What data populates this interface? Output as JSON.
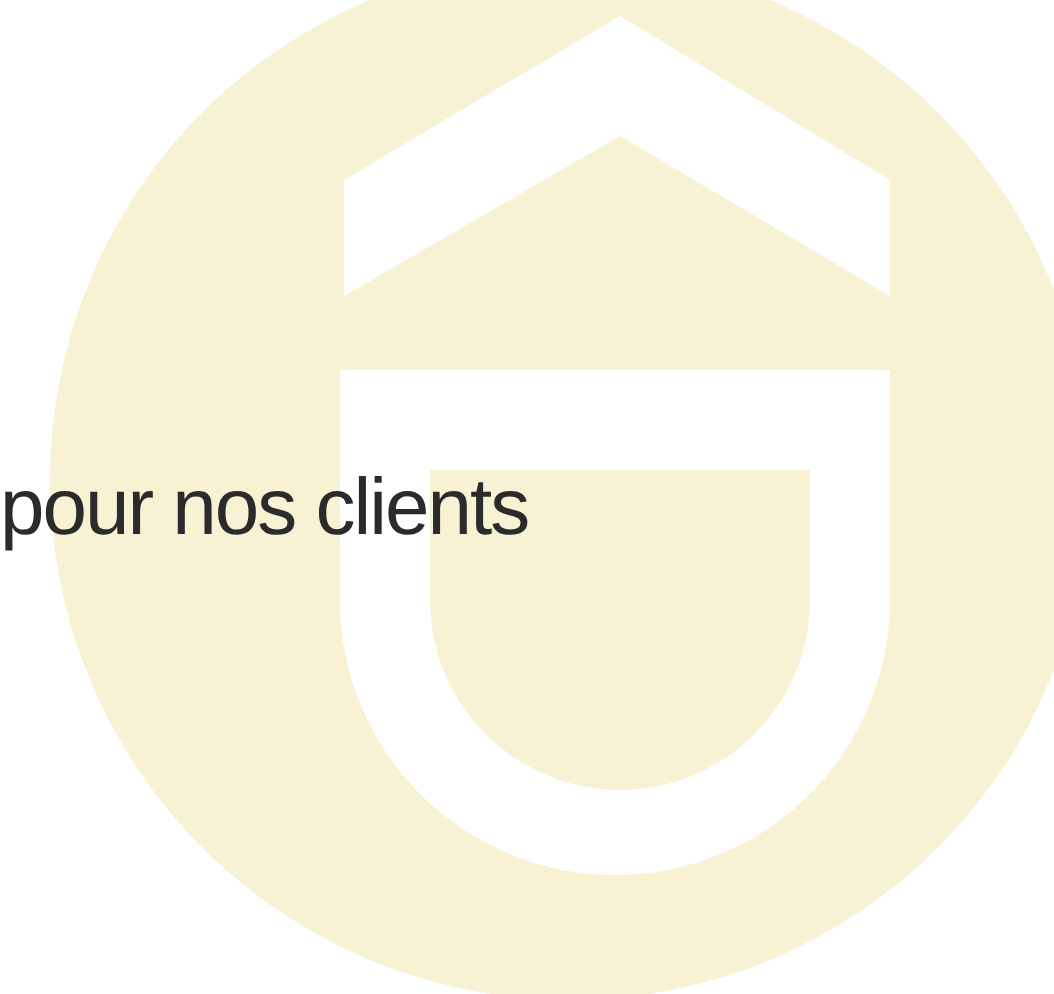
{
  "heading": "pour nos clients"
}
